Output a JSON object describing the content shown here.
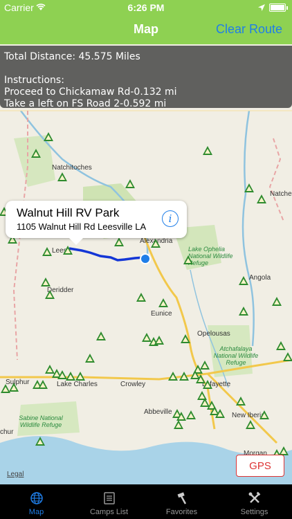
{
  "status": {
    "carrier": "Carrier",
    "time": "6:26 PM"
  },
  "navbar": {
    "title": "Map",
    "clear_label": "Clear Route"
  },
  "info": {
    "total": "Total Distance: 45.575 Miles",
    "heading": "Instructions:",
    "lines": [
      "Proceed to Chickamaw Rd-0.132 mi",
      "Take a left on FS Road 2-0.592 mi"
    ]
  },
  "callout": {
    "name": "Walnut Hill RV Park",
    "address": "1105 Walnut Hill Rd Leesville LA"
  },
  "map_labels": {
    "natchitoches": "Natchitoches",
    "natchez": "Natche",
    "alexandria": "Alexandria",
    "leesville": "Leesv",
    "deridder": "Deridder",
    "lake_ophelia": "Lake Ophelia National Wildlife Refuge",
    "angola": "Angola",
    "eunice": "Eunice",
    "opelousas": "Opelousas",
    "atchafalaya": "Atchafalaya National Wildlife Refuge",
    "sulphur": "Sulphur",
    "lake_charles": "Lake Charles",
    "crowley": "Crowley",
    "lafayette": "Lafayette",
    "sabine": "Sabine National Wildlife Refuge",
    "abbeville": "Abbeville",
    "new_iberia": "New Iberia",
    "morgan": "Morgan",
    "chur": "chur"
  },
  "gps_label": "GPS",
  "legal_label": "Legal",
  "tabs": [
    "Map",
    "Camps List",
    "Favorites",
    "Settings"
  ],
  "colors": {
    "header": "#8ed152",
    "accent": "#1f7ee8",
    "route": "#1436d6",
    "camp_marker": "#2e8b2e"
  }
}
